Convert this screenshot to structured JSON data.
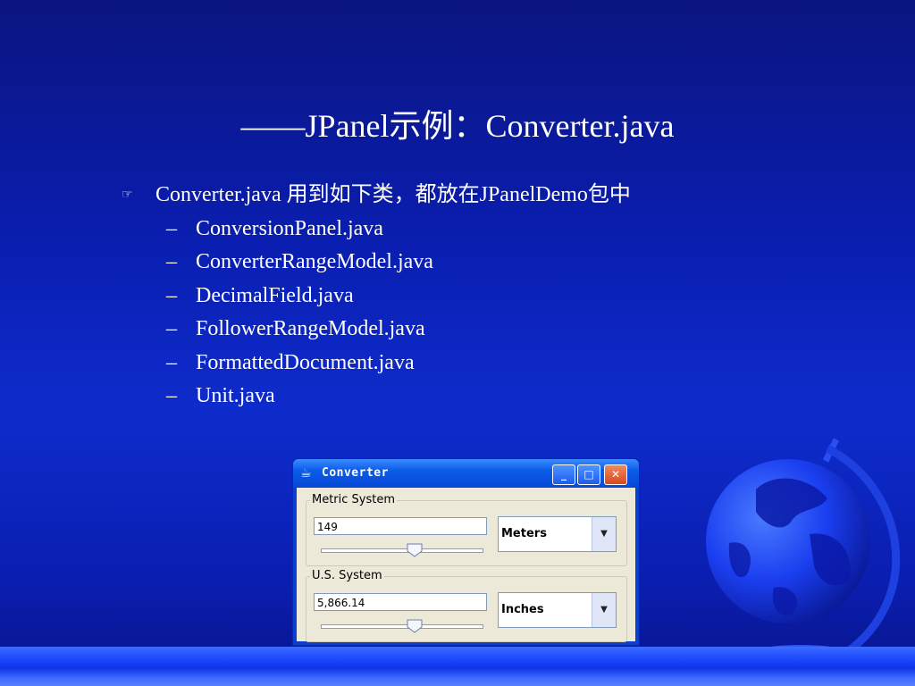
{
  "slide": {
    "title": "——JPanel示例：Converter.java",
    "bullet": {
      "marker": "☞",
      "text": "Converter.java 用到如下类，都放在JPanelDemo包中"
    },
    "sub_items": [
      "ConversionPanel.java",
      "ConverterRangeModel.java",
      "DecimalField.java",
      "FollowerRangeModel.java",
      "FormattedDocument.java",
      "Unit.java"
    ],
    "sub_marker": "–"
  },
  "window": {
    "title": "Converter",
    "icon": "java-cup-icon",
    "metric": {
      "label": "Metric System",
      "value": "149",
      "unit": "Meters"
    },
    "us": {
      "label": "U.S. System",
      "value": "5,866.14",
      "unit": "Inches"
    }
  },
  "colors": {
    "background": "#0a1eb0",
    "title_bar": "#0a5ce8",
    "close_button": "#d9491f",
    "panel": "#ece9d8"
  }
}
